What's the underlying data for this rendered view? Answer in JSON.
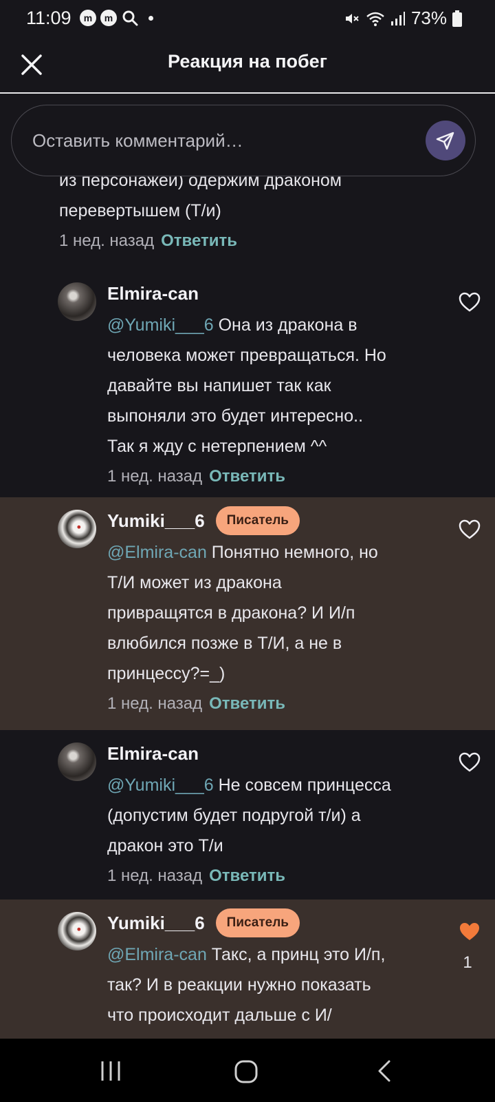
{
  "status_bar": {
    "time": "11:09",
    "battery": "73%",
    "app_badge_1": "m",
    "app_badge_2": "m",
    "icons": [
      "app-notification-icon",
      "app-notification-icon",
      "search-icon",
      "dot-icon",
      "mute-icon",
      "wifi-icon",
      "signal-icon",
      "battery-icon"
    ]
  },
  "header": {
    "title": "Реакция на побег",
    "close_icon": "close-icon"
  },
  "comment_bar": {
    "placeholder": "Оставить комментарий…",
    "send_icon": "send-icon"
  },
  "fragment": {
    "line1": "из персонажей) одержим драконом",
    "line2": "перевертышем (Т/и)",
    "time": "1 нед. назад",
    "reply": "Ответить"
  },
  "comments": [
    {
      "author": "Elmira-can",
      "badge": "",
      "mention": "@Yumiki___6",
      "lines": [
        " Она из дракона в",
        "человека может превращаться. Но",
        "давайте вы напишет так как",
        "выпоняли это будет интересно..",
        "Так я жду с нетерпением ^^"
      ],
      "time": "1 нед. назад",
      "reply": "Ответить",
      "liked": false,
      "like_count": ""
    },
    {
      "author": "Yumiki___6",
      "badge": "Писатель",
      "mention": "@Elmira-can",
      "lines": [
        " Понятно немного, но",
        "Т/И может из дракона",
        "привращятся в дракона? И И/п",
        "влюбился позже в Т/И, а не в",
        "принцессу?=_)"
      ],
      "time": "1 нед. назад",
      "reply": "Ответить",
      "liked": false,
      "like_count": ""
    },
    {
      "author": "Elmira-can",
      "badge": "",
      "mention": "@Yumiki___6",
      "lines": [
        " Не совсем принцесса",
        "(допустим будет подругой т/и) а",
        "дракон это Т/и"
      ],
      "time": "1 нед. назад",
      "reply": "Ответить",
      "liked": false,
      "like_count": ""
    },
    {
      "author": "Yumiki___6",
      "badge": "Писатель",
      "mention": "@Elmira-can",
      "lines": [
        " Такс, а принц это И/п,",
        "так? И в реакции нужно показать",
        "что происходит дальше с И/"
      ],
      "time": "",
      "reply": "",
      "liked": true,
      "like_count": "1"
    }
  ],
  "colors": {
    "background": "#17161b",
    "writer_highlight": "#3a302c",
    "accent_reply": "#79b8b8",
    "mention": "#6fa7b5",
    "badge": "#f7a57c",
    "liked_heart": "#f27a3a",
    "send_button": "#50497a"
  },
  "nav_bar": {
    "recents_icon": "recents-icon",
    "home_icon": "home-icon",
    "back_icon": "back-icon"
  }
}
